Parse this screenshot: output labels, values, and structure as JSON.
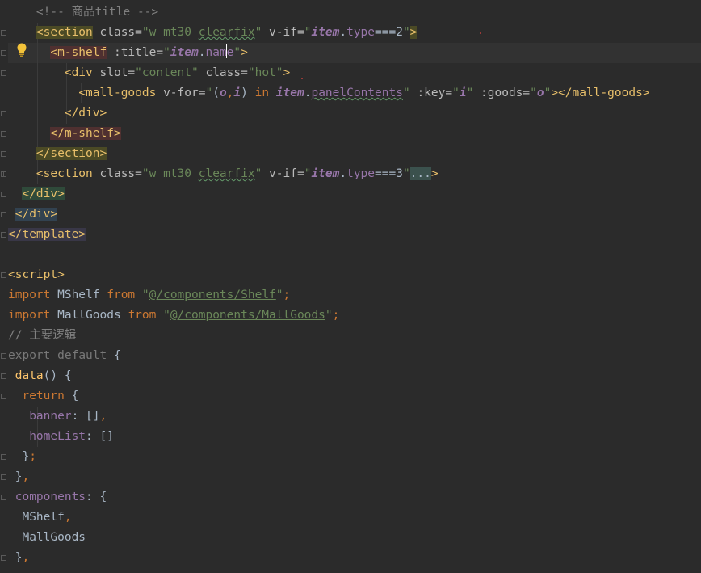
{
  "editor": {
    "lines": {
      "l1": {
        "indent": "    ",
        "comment": "<!-- 商品title -->"
      },
      "l2": {
        "indent": "    ",
        "open": "<section",
        "attr_class": "class=",
        "class_q1": "\"w mt30 ",
        "class_typo": "clearfix",
        "class_q2": "\"",
        "attr_vif": "v-if=",
        "q1": "\"",
        "item": "item",
        "dot": ".",
        "prop": "type",
        "rest": "===2",
        "q2": "\"",
        "close": ">"
      },
      "l3": {
        "indent": "      ",
        "open": "<m-shelf",
        "attr_title": ":title=",
        "q1": "\"",
        "item": "item",
        "dot": ".",
        "prop_a": "nam",
        "prop_b": "e",
        "q2": "\"",
        "close": ">"
      },
      "l4": {
        "indent": "        ",
        "open": "<div",
        "attr_slot": "slot=",
        "slot_val": "\"content\"",
        "attr_class": "class=",
        "class_val": "\"hot\"",
        "close": ">"
      },
      "l5": {
        "indent": "          ",
        "open": "<mall-goods",
        "attr_vfor": "v-for=",
        "q1": "\"",
        "paren_open": "(",
        "o": "o",
        "comma": ",",
        "i": "i",
        "paren_close": ")",
        "in_kw": "in",
        "item": "item",
        "dot": ".",
        "prop": "panelContents",
        "q2": "\"",
        "attr_key": ":key=",
        "kq1": "\"",
        "key_i": "i",
        "kq2": "\"",
        "attr_goods": ":goods=",
        "gq1": "\"",
        "goods_o": "o",
        "gq2": "\"",
        "end": "></mall-goods>"
      },
      "l6": {
        "indent": "        ",
        "tag": "</div>"
      },
      "l7": {
        "indent": "      ",
        "tag": "</m-shelf>"
      },
      "l8": {
        "indent": "    ",
        "tag": "</section>"
      },
      "l9": {
        "indent": "    ",
        "open": "<section",
        "attr_class": "class=",
        "class_q1": "\"w mt30 ",
        "class_typo": "clearfix",
        "class_q2": "\"",
        "attr_vif": "v-if=",
        "q1": "\"",
        "item": "item",
        "dot": ".",
        "prop": "type",
        "rest": "===3",
        "q2": "\"",
        "folded": "...",
        "close": ">"
      },
      "l10": {
        "indent": "  ",
        "tag": "</div>"
      },
      "l11": {
        "indent": " ",
        "tag": "</div>"
      },
      "l12": {
        "tag": "</template>"
      },
      "l14": {
        "tag": "<script>"
      },
      "l15": {
        "kw": "import",
        "name": " MShelf ",
        "from": "from",
        "q1": "\"",
        "path": "@/components/Shelf",
        "q2": "\"",
        "semi": ";"
      },
      "l16": {
        "kw": "import",
        "name": " MallGoods ",
        "from": "from",
        "q1": "\"",
        "path": "@/components/MallGoods",
        "q2": "\"",
        "semi": ";"
      },
      "l17": {
        "comment": "// 主要逻辑"
      },
      "l18": {
        "kw1": "export",
        "kw2": "default",
        "brace": " {"
      },
      "l19": {
        "indent": " ",
        "func": "data",
        "rest": "() {"
      },
      "l20": {
        "indent": "  ",
        "kw": "return",
        "rest": " {"
      },
      "l21": {
        "indent": "   ",
        "prop": "banner",
        "rest": ": []",
        "comma": ","
      },
      "l22": {
        "indent": "   ",
        "prop": "homeList",
        "rest": ": []"
      },
      "l23": {
        "indent": "  ",
        "brace": "}",
        "semi": ";"
      },
      "l24": {
        "indent": " ",
        "brace": "}",
        "comma": ","
      },
      "l25": {
        "indent": " ",
        "prop": "components",
        "rest": ": {"
      },
      "l26": {
        "indent": "  ",
        "name": "MShelf",
        "comma": ","
      },
      "l27": {
        "indent": "  ",
        "name": "MallGoods"
      },
      "l28": {
        "indent": " ",
        "brace": "}",
        "comma": ","
      }
    }
  },
  "colors": {
    "background": "#2b2b2b",
    "tag": "#e8bf6a",
    "keyword": "#cc7832",
    "string": "#6a8759",
    "variable": "#9876aa",
    "function": "#ffc66d",
    "comment": "#808080",
    "text": "#a9b7c6"
  },
  "icons": {
    "intention": "lightbulb-icon",
    "fold": "fold-marker-icon"
  }
}
